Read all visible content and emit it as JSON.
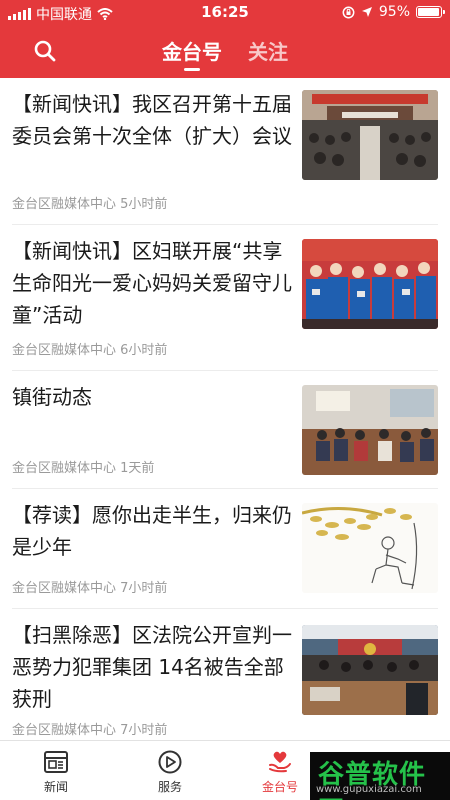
{
  "status_bar": {
    "carrier": "中国联通",
    "time": "16:25",
    "battery": "95%",
    "battery_level": 0.95
  },
  "header": {
    "tabs": [
      {
        "label": "金台号",
        "active": true
      },
      {
        "label": "关注",
        "active": false
      }
    ],
    "icons": {
      "search": "search-icon"
    }
  },
  "articles": [
    {
      "title": "【新闻快讯】我区召开第十五届委员会第十次全体（扩大）会议",
      "source": "金台区融媒体中心",
      "time": "5小时前",
      "image": "meeting-hall-photo"
    },
    {
      "title": "【新闻快讯】区妇联开展“共享生命阳光一爱心妈妈关爱留守儿童”活动",
      "source": "金台区融媒体中心",
      "time": "6小时前",
      "image": "children-group-photo"
    },
    {
      "title": "镇街动态",
      "source": "金台区融媒体中心",
      "time": "1天前",
      "image": "conference-room-photo"
    },
    {
      "title": "【荐读】愿你出走半生，归来仍是少年",
      "source": "金台区融媒体中心",
      "time": "7小时前",
      "image": "ink-sketch-illustration"
    },
    {
      "title": "【扫黑除恶】区法院公开宣判一恶势力犯罪集团 14名被告全部获刑",
      "source": "金台区融媒体中心",
      "time": "7小时前",
      "image": "courtroom-photo"
    }
  ],
  "bottom_nav": [
    {
      "label": "新闻",
      "icon": "newspaper-icon",
      "active": false
    },
    {
      "label": "服务",
      "icon": "play-circle-icon",
      "active": false
    },
    {
      "label": "金台号",
      "icon": "heart-hand-icon",
      "active": true
    }
  ],
  "watermark": {
    "main": "谷普软件园",
    "sub": "www.gupuxiazai.com"
  },
  "colors": {
    "brand_red": "#e4393c",
    "meta_gray": "#9a9a9a",
    "watermark_green": "#25c24a"
  }
}
